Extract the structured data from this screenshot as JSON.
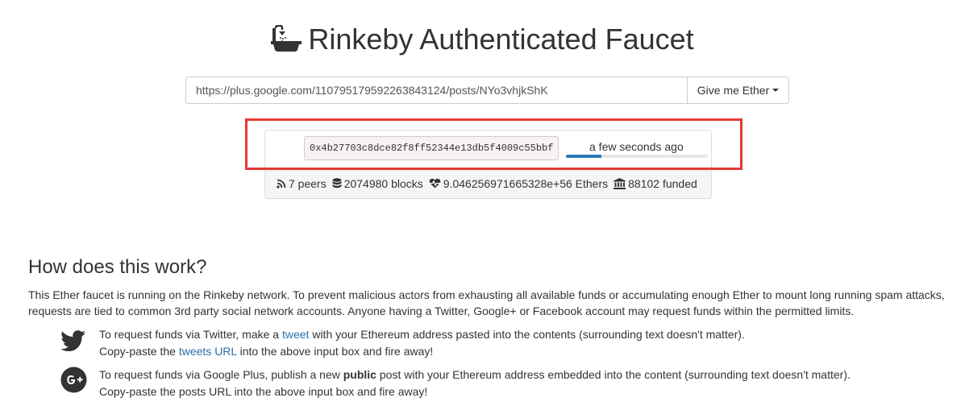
{
  "header": {
    "title": "Rinkeby Authenticated Faucet",
    "title_icon": "bath-icon"
  },
  "request": {
    "url_value": "https://plus.google.com/110795179592263843124/posts/NYo3vhjkShK",
    "button_label": "Give me Ether"
  },
  "queue": {
    "address": "0x4b27703c8dce82f8ff52344e13db5f4009c55bbf",
    "time": "a few seconds ago",
    "progress_fraction": 0.25
  },
  "stats": {
    "peers": "7 peers",
    "blocks": "2074980 blocks",
    "ethers": "9.046256971665328e+56 Ethers",
    "funded": "88102 funded"
  },
  "colors": {
    "highlight": "#e53935",
    "link": "#2a6fa8",
    "progress": "#2a7bb8"
  },
  "howto": {
    "heading": "How does this work?",
    "description": "This Ether faucet is running on the Rinkeby network. To prevent malicious actors from exhausting all available funds or accumulating enough Ether to mount long running spam attacks, requests are tied to common 3rd party social network accounts. Anyone having a Twitter, Google+ or Facebook account may request funds within the permitted limits.",
    "twitter": {
      "line1_pre": "To request funds via Twitter, make a ",
      "line1_link": "tweet",
      "line1_post": " with your Ethereum address pasted into the contents (surrounding text doesn't matter).",
      "line2_pre": "Copy-paste the ",
      "line2_link": "tweets URL",
      "line2_post": " into the above input box and fire away!"
    },
    "gplus": {
      "line1_pre": "To request funds via Google Plus, publish a new ",
      "line1_bold": "public",
      "line1_post": " post with your Ethereum address embedded into the content (surrounding text doesn't matter).",
      "line2": "Copy-paste the posts URL into the above input box and fire away!"
    }
  }
}
